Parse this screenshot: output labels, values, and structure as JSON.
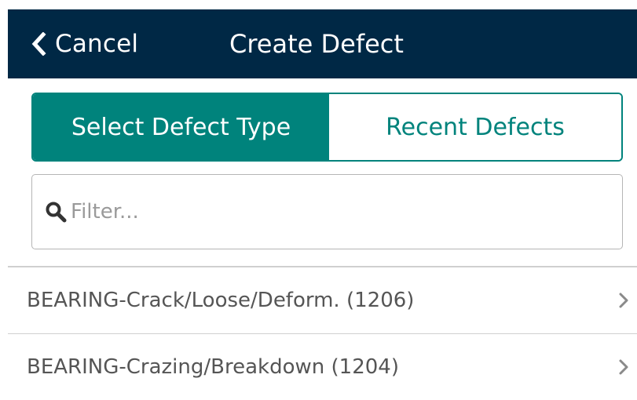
{
  "header": {
    "cancel_label": "Cancel",
    "title": "Create Defect",
    "background_color": "#002845",
    "back_icon": "chevron-left-icon"
  },
  "tabs": [
    {
      "label": "Select Defect Type",
      "active": true
    },
    {
      "label": "Recent Defects",
      "active": false
    }
  ],
  "accent_color": "#00837c",
  "filter": {
    "placeholder": "Filter...",
    "value": "",
    "icon": "search-icon"
  },
  "defect_list": {
    "items": [
      {
        "label": "BEARING-Crack/Loose/Deform. (1206)",
        "icon": "chevron-right-icon"
      },
      {
        "label": "BEARING-Crazing/Breakdown (1204)",
        "icon": "chevron-right-icon"
      }
    ]
  }
}
